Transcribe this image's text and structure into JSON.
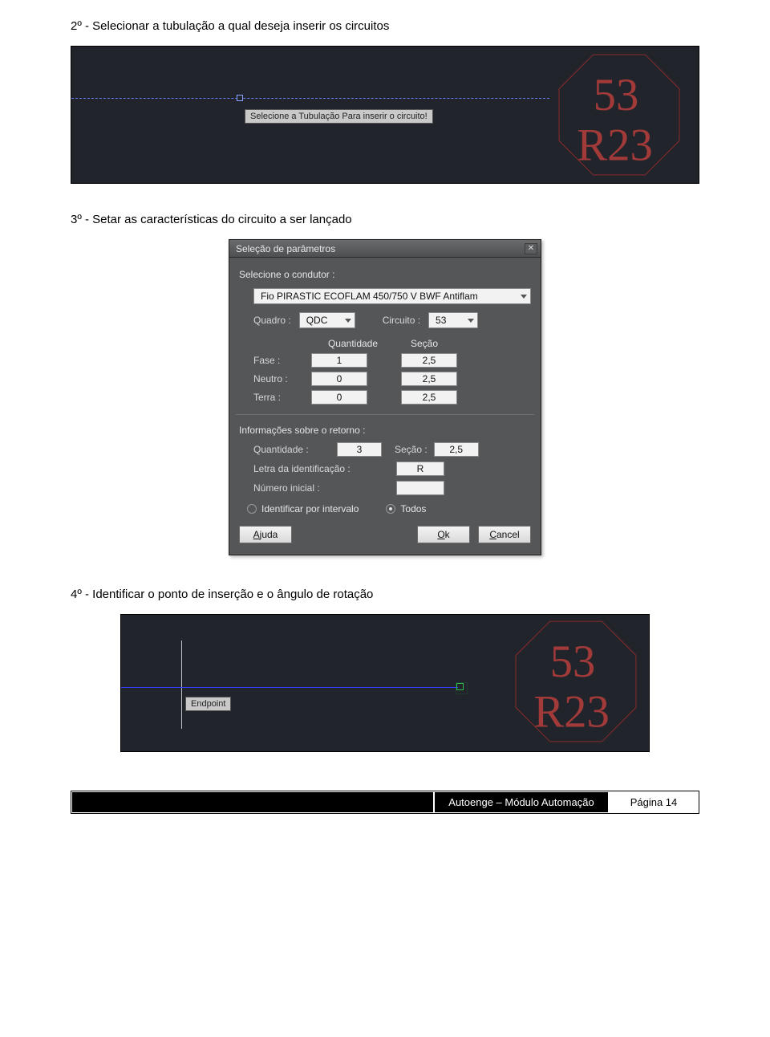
{
  "steps": {
    "s2": "2º  -  Selecionar a tubulação a qual deseja inserir os circuitos",
    "s3": "3º  -  Setar as características do circuito a ser lançado",
    "s4": "4º  -  Identificar o ponto de inserção e o ângulo de rotação"
  },
  "cad1": {
    "tooltip": "Selecione a Tubulação Para inserir o circuito!",
    "oct_top": "53",
    "oct_bot": "R23"
  },
  "cad2": {
    "tooltip": "Endpoint",
    "oct_top": "53",
    "oct_bot": "R23"
  },
  "dialog": {
    "title": "Seleção de parâmetros",
    "close_glyph": "✕",
    "sel_condutor": "Selecione o condutor :",
    "condutor_value": "Fio PIRASTIC ECOFLAM 450/750 V BWF Antiflam",
    "quadro_label": "Quadro :",
    "quadro_value": "QDC",
    "circuito_label": "Circuito :",
    "circuito_value": "53",
    "col_qty": "Quantidade",
    "col_sec": "Seção",
    "rows": {
      "fase": {
        "label": "Fase :",
        "qty": "1",
        "sec": "2,5"
      },
      "neutro": {
        "label": "Neutro :",
        "qty": "0",
        "sec": "2,5"
      },
      "terra": {
        "label": "Terra :",
        "qty": "0",
        "sec": "2,5"
      }
    },
    "ret_title": "Informações sobre o retorno :",
    "ret_qty_label": "Quantidade :",
    "ret_qty": "3",
    "ret_sec_label": "Seção :",
    "ret_sec": "2,5",
    "ret_letter_label": "Letra da identificação :",
    "ret_letter": "R",
    "ret_num_label": "Número inicial :",
    "ret_num": "",
    "radio_interval": "Identificar por intervalo",
    "radio_all": "Todos",
    "btn_help": "Ajuda",
    "btn_ok": "Ok",
    "btn_cancel": "Cancel"
  },
  "footer": {
    "mid": "Autoenge – Módulo Automação",
    "right": "Página 14"
  }
}
